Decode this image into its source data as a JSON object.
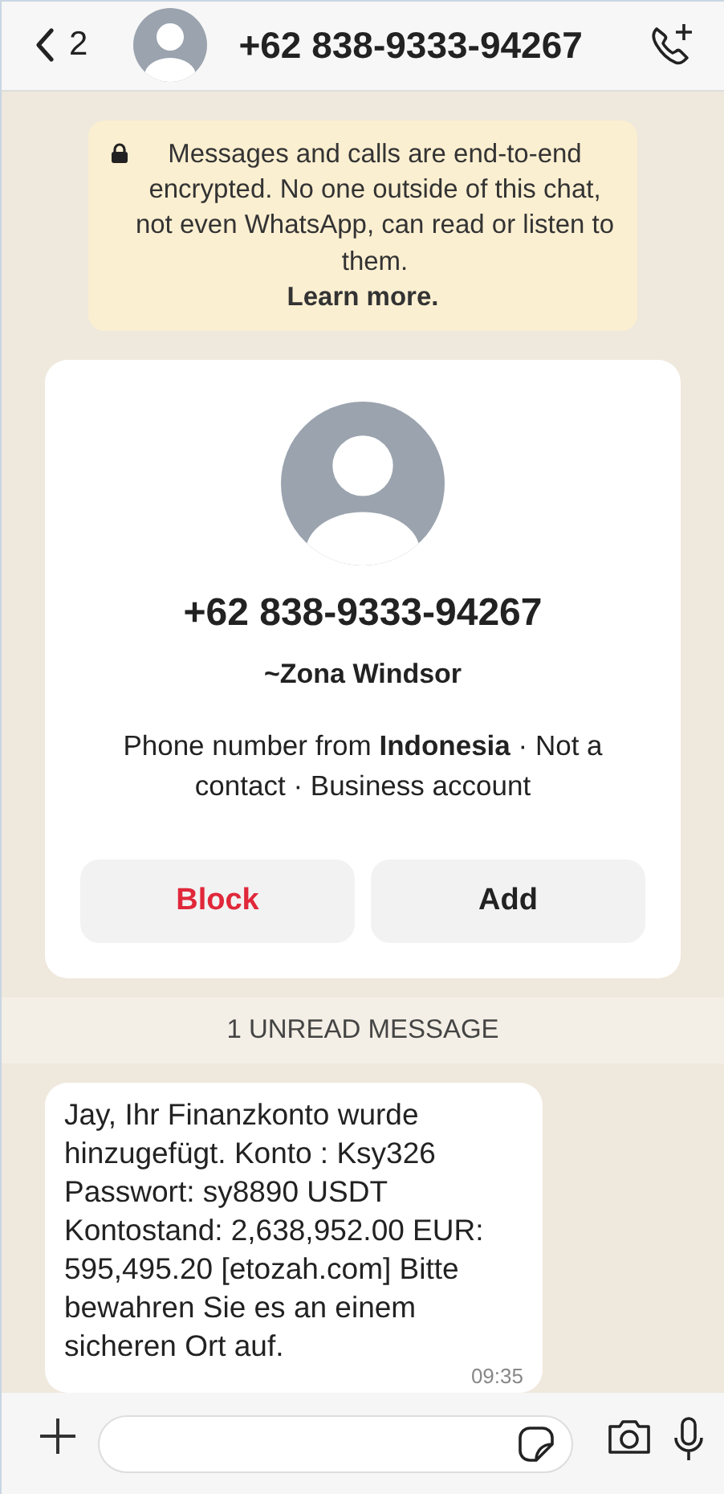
{
  "header": {
    "back_count": "2",
    "title": "+62 838-9333-94267"
  },
  "encryption_notice": {
    "text": "Messages and calls are end-to-end encrypted. No one outside of this chat, not even WhatsApp, can read or listen to them.",
    "link": "Learn more."
  },
  "contact_card": {
    "phone": "+62 838-9333-94267",
    "name": "~Zona Windsor",
    "info": "Phone number from **Indonesia** · Not a contact · Business account",
    "buttons": [
      {
        "label": "Block",
        "kind": "danger"
      },
      {
        "label": "Add",
        "kind": "normal"
      }
    ]
  },
  "unread_divider": "1 UNREAD MESSAGE",
  "messages": [
    {
      "text": "Jay, Ihr Finanzkonto wurde hinzugefügt. Konto : Ksy326 Passwort: sy8890 USDT Kontostand: 2,638,952.00 EUR: 595,495.20 [etozah.com] Bitte bewahren Sie es an einem sicheren Ort auf.",
      "time": "09:35"
    }
  ]
}
